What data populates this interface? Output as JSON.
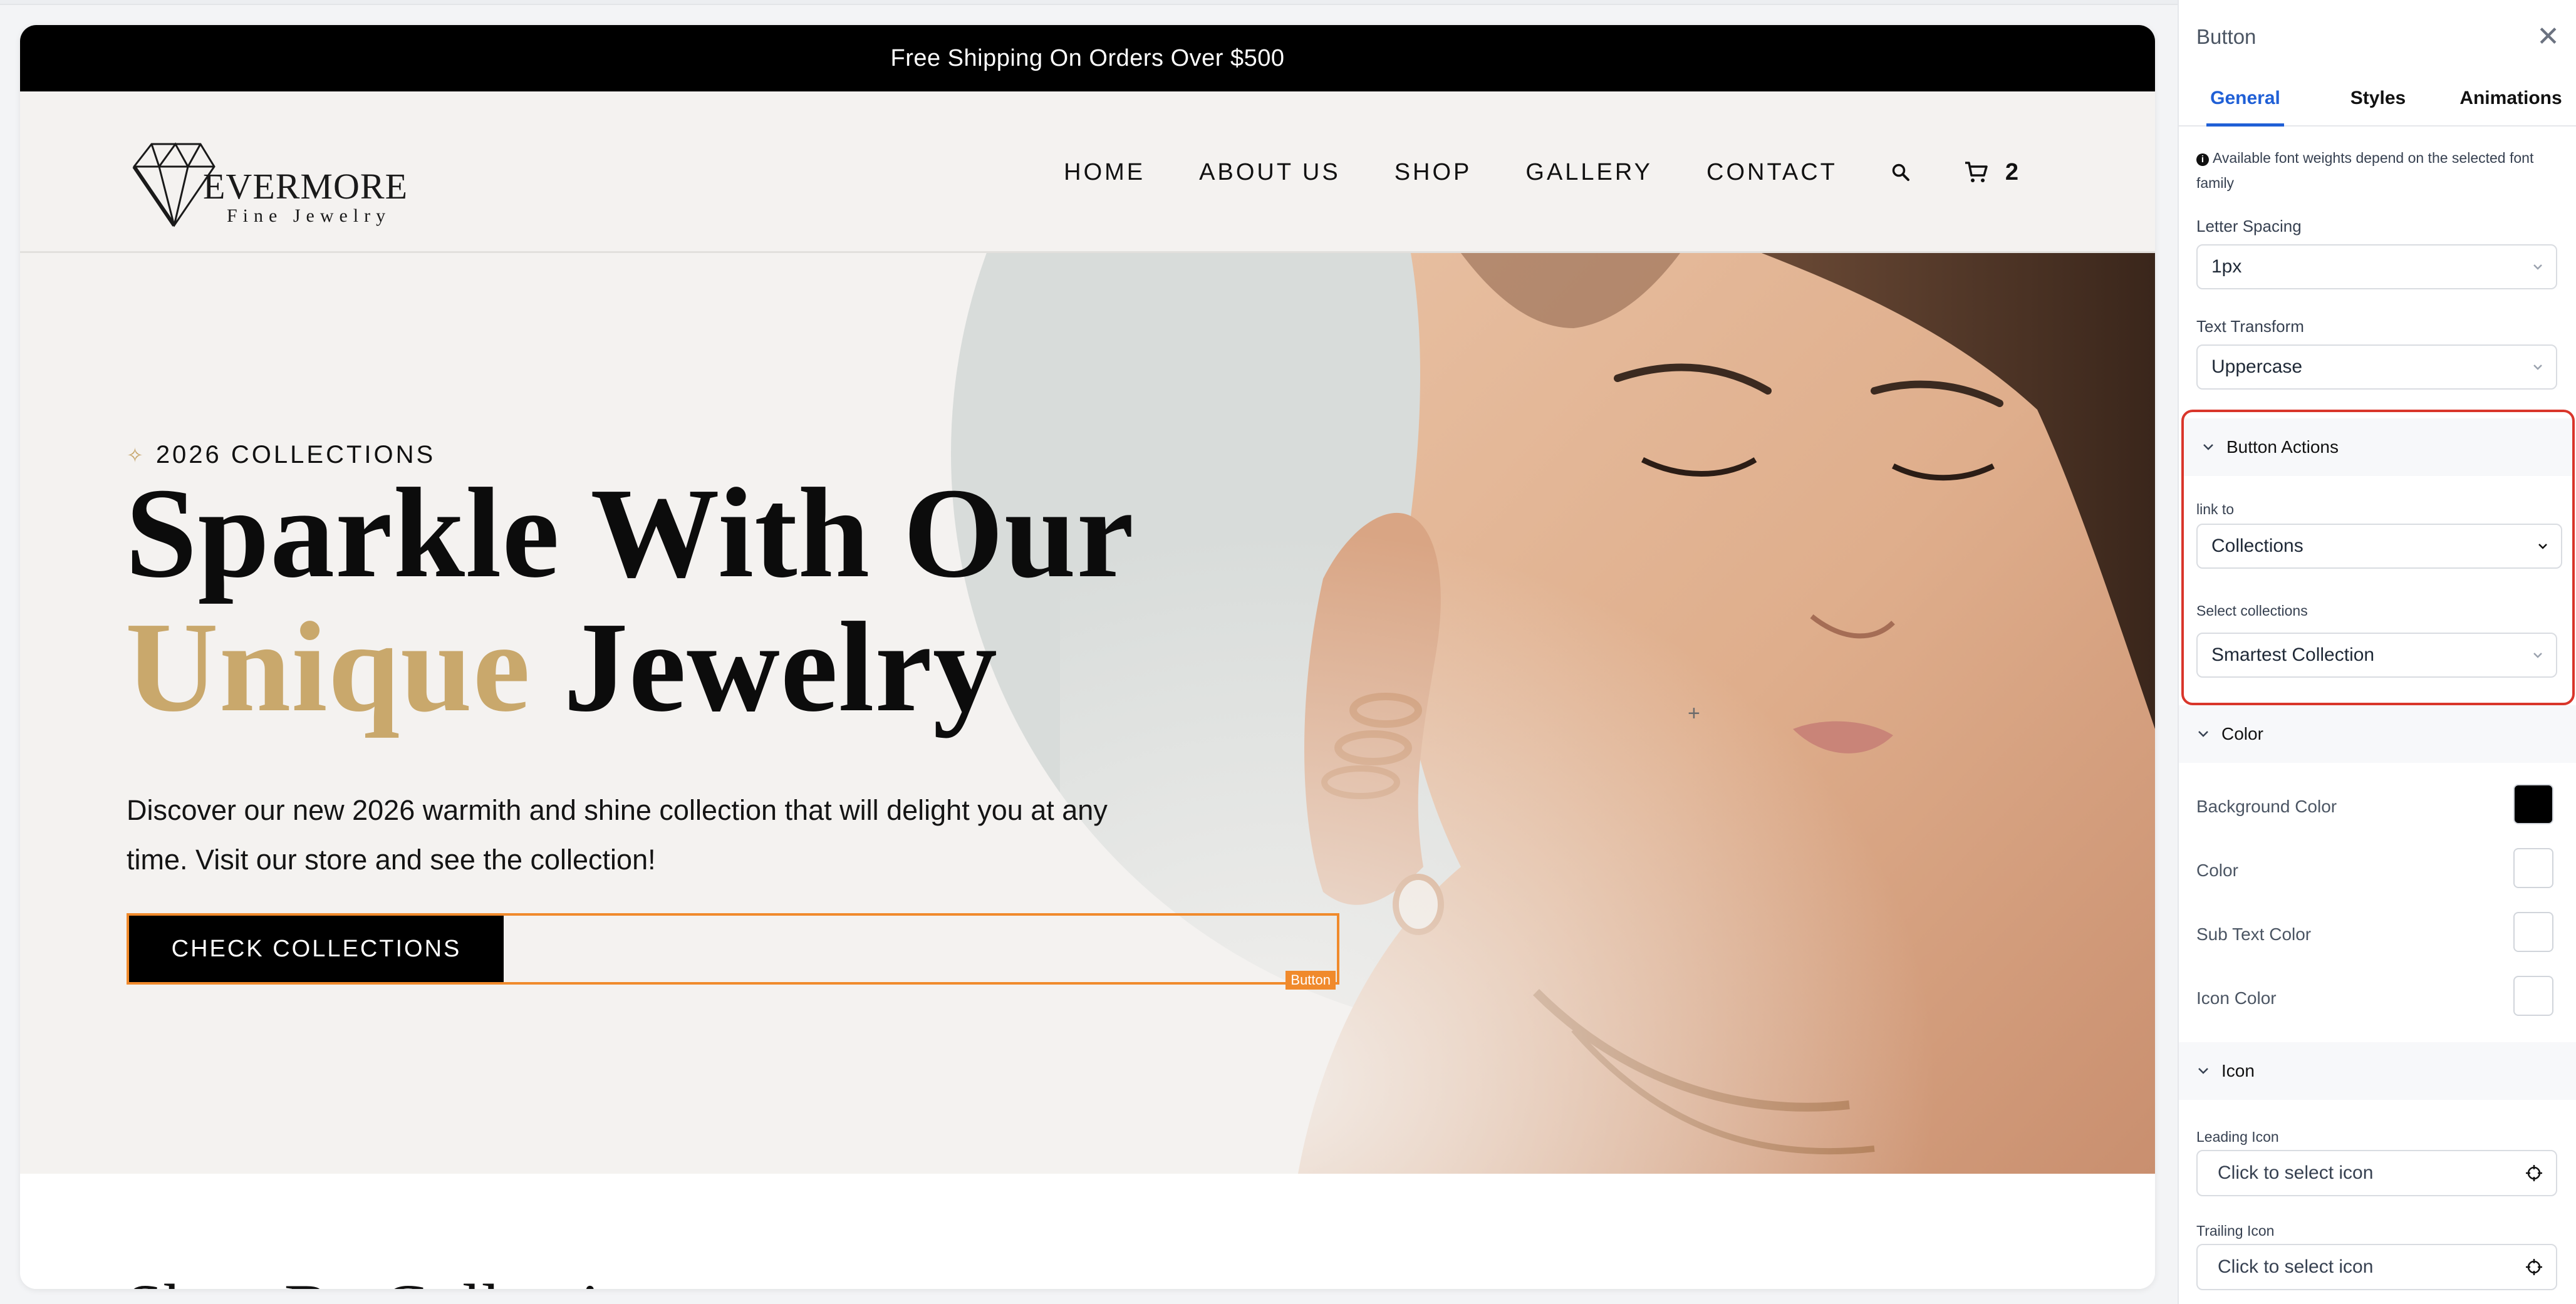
{
  "announcement": "Free Shipping On Orders Over $500",
  "brand": {
    "name": "EVERMORE",
    "tagline": "Fine Jewelry"
  },
  "nav": {
    "items": [
      "HOME",
      "ABOUT US",
      "SHOP",
      "GALLERY",
      "CONTACT"
    ],
    "cart_count": "2"
  },
  "hero": {
    "eyebrow": "2026 COLLECTIONS",
    "headline_line1": "Sparkle With Our",
    "headline_accent": "Unique",
    "headline_rest": "Jewelry",
    "description": "Discover our new 2026 warmith and shine collection that will delight you at any time. Visit our store and see the collection!",
    "cta_label": "CHECK COLLECTIONS",
    "selection_tag": "Button"
  },
  "next_section_title": "Shop By Collection",
  "panel": {
    "title": "Button",
    "tabs": [
      "General",
      "Styles",
      "Animations"
    ],
    "active_tab": "General",
    "font_note": "Available font weights depend on the selected font family",
    "letter_spacing": {
      "label": "Letter Spacing",
      "value": "1px"
    },
    "text_transform": {
      "label": "Text Transform",
      "value": "Uppercase"
    },
    "button_actions": {
      "title": "Button Actions",
      "link_to_label": "link to",
      "link_to_value": "Collections",
      "collections_label": "Select collections",
      "collections_value": "Smartest Collection"
    },
    "color": {
      "title": "Color",
      "rows": [
        {
          "label": "Background Color",
          "value": "#000000"
        },
        {
          "label": "Color",
          "value": "#ffffff"
        },
        {
          "label": "Sub Text Color",
          "value": "#ffffff"
        },
        {
          "label": "Icon Color",
          "value": "#ffffff"
        }
      ]
    },
    "icon": {
      "title": "Icon",
      "leading_label": "Leading Icon",
      "leading_placeholder": "Click to select icon",
      "trailing_label": "Trailing Icon",
      "trailing_placeholder": "Click to select icon"
    }
  },
  "colors": {
    "accent_gold": "#c9a86c",
    "selection_orange": "#f08a2c",
    "highlight_red": "#d9362b",
    "tab_blue": "#1f5fd6"
  },
  "icons": [
    "diamond-logo-icon",
    "sparkle-icon",
    "search-icon",
    "cart-icon",
    "close-icon",
    "chevron-down-icon",
    "crosshair-icon",
    "info-icon"
  ]
}
